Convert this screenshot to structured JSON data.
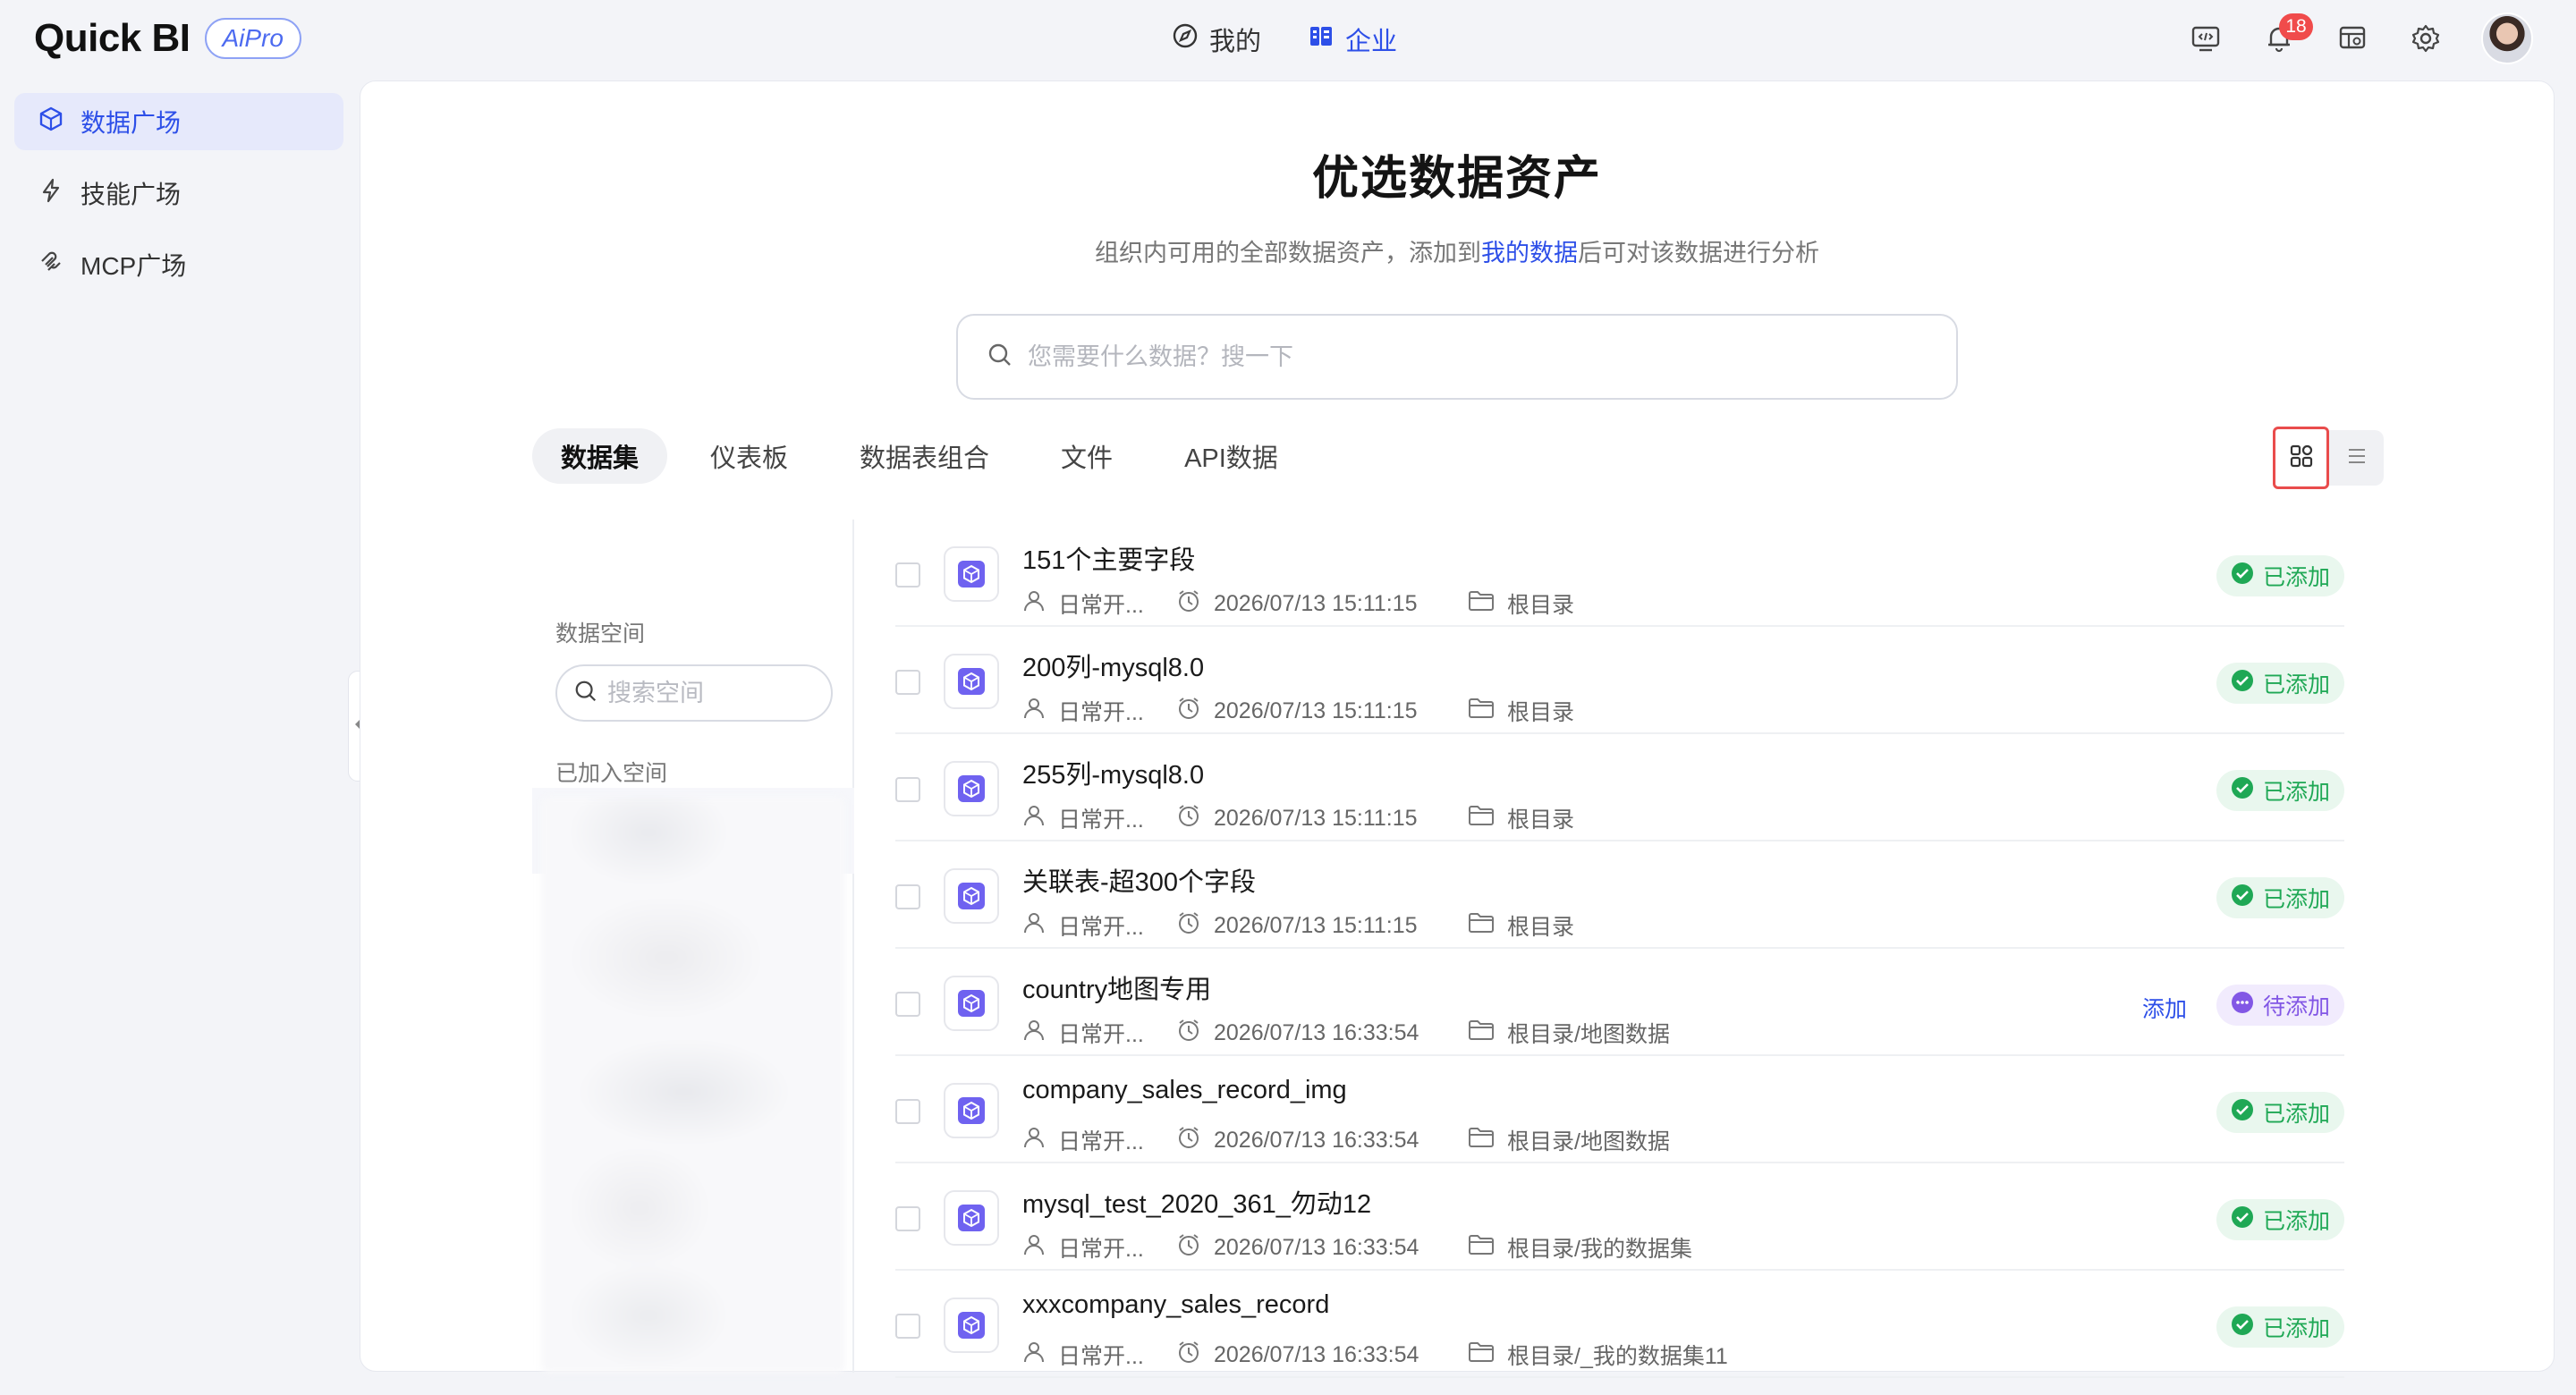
{
  "app": {
    "logo_text": "Quick BI",
    "logo_badge": "AiPro"
  },
  "topnav": {
    "mine": "我的",
    "enterprise": "企业",
    "notification_count": "18"
  },
  "sidebar": {
    "items": [
      {
        "label": "数据广场",
        "icon": "cube-icon",
        "active": true
      },
      {
        "label": "技能广场",
        "icon": "lightning-icon",
        "active": false
      },
      {
        "label": "MCP广场",
        "icon": "mcp-icon",
        "active": false
      }
    ]
  },
  "main": {
    "title": "优选数据资产",
    "subtitle_before": "组织内可用的全部数据资产，添加到",
    "subtitle_link": "我的数据",
    "subtitle_after": "后可对该数据进行分析",
    "search_placeholder": "您需要什么数据？搜一下",
    "tabs": [
      "数据集",
      "仪表板",
      "数据表组合",
      "文件",
      "API数据"
    ],
    "active_tab": "数据集"
  },
  "space_panel": {
    "title": "数据空间",
    "search_placeholder": "搜索空间",
    "joined_label": "已加入空间"
  },
  "rows": [
    {
      "name": "151个主要字段",
      "owner": "日常开...",
      "time": "2026/07/13 15:11:15",
      "path": "根目录",
      "status": "已添加"
    },
    {
      "name": "200列-mysql8.0",
      "owner": "日常开...",
      "time": "2026/07/13 15:11:15",
      "path": "根目录",
      "status": "已添加"
    },
    {
      "name": "255列-mysql8.0",
      "owner": "日常开...",
      "time": "2026/07/13 15:11:15",
      "path": "根目录",
      "status": "已添加"
    },
    {
      "name": "关联表-超300个字段",
      "owner": "日常开...",
      "time": "2026/07/13 15:11:15",
      "path": "根目录",
      "status": "已添加"
    },
    {
      "name": "country地图专用",
      "owner": "日常开...",
      "time": "2026/07/13 16:33:54",
      "path": "根目录/地图数据",
      "status": "待添加",
      "add_label": "添加"
    },
    {
      "name": "company_sales_record_img",
      "owner": "日常开...",
      "time": "2026/07/13 16:33:54",
      "path": "根目录/地图数据",
      "status": "已添加"
    },
    {
      "name": "mysql_test_2020_361_勿动12",
      "owner": "日常开...",
      "time": "2026/07/13 16:33:54",
      "path": "根目录/我的数据集",
      "status": "已添加"
    },
    {
      "name": "xxxcompany_sales_record",
      "owner": "日常开...",
      "time": "2026/07/13 16:33:54",
      "path": "根目录/_我的数据集11",
      "status": "已添加"
    }
  ],
  "colors": {
    "accent": "#2d4fe8",
    "done": "#1fa855",
    "pending": "#8257e5",
    "dataset_icon": "#6f62f0",
    "highlight_border": "#e94c4c"
  }
}
